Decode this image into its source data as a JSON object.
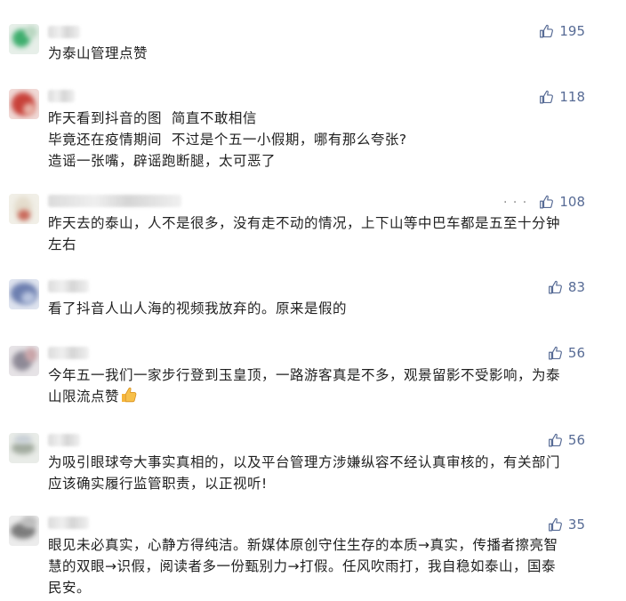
{
  "comments": [
    {
      "lines": [
        "为泰山管理点赞"
      ],
      "likes": "195"
    },
    {
      "lines": [
        "昨天看到抖音的图  简直不敢相信",
        "毕竟还在疫情期间  不过是个五一小假期，哪有那么夸张?",
        "造谣一张嘴，辟谣跑断腿，太可恶了"
      ],
      "likes": "118"
    },
    {
      "lines": [
        "昨天去的泰山，人不是很多，没有走不动的情况，上下山等中巴车都是五至十分钟",
        "左右"
      ],
      "likes": "108",
      "more_label": "· · ·"
    },
    {
      "lines": [
        "看了抖音人山人海的视频我放弃的。原来是假的"
      ],
      "likes": "83"
    },
    {
      "lines": [
        "今年五一我们一家步行登到玉皇顶，一路游客真是不多，观景留影不受影响，为泰",
        "山限流点赞"
      ],
      "likes": "56",
      "emoji": "thumbs-up-emoji"
    },
    {
      "lines": [
        "为吸引眼球夸大事实真相的，以及平台管理方涉嫌纵容不经认真审核的，有关部门",
        "应该确实履行监管职责，以正视听!"
      ],
      "likes": "56"
    },
    {
      "lines": [
        "眼见未必真实，心静方得纯洁。新媒体原创守住生存的本质→真实，传播者擦亮智",
        "慧的双眼→识假，阅读者多一份甄别力→打假。任风吹雨打，我自稳如泰山，国泰",
        "民安。"
      ],
      "likes": "35"
    }
  ],
  "colors": {
    "like": "#576b95",
    "text": "#1f1f1f",
    "more": "#8a8a8a"
  },
  "icons": {
    "like": "thumb-up-outline-icon",
    "more": "ellipsis-icon"
  }
}
